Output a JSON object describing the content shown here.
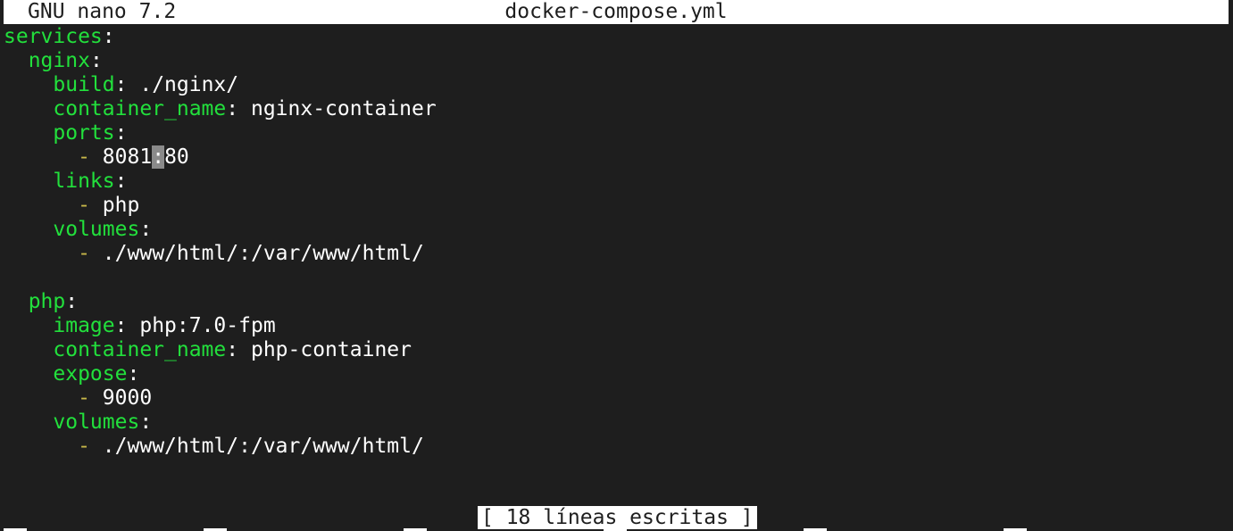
{
  "titlebar": {
    "app_version": "GNU nano 7.2",
    "file_name": "docker-compose.yml"
  },
  "editor": {
    "lines": [
      {
        "indent": "",
        "key": "services",
        "sep": ":",
        "dash": "",
        "value": ""
      },
      {
        "indent": "  ",
        "key": "nginx",
        "sep": ":",
        "dash": "",
        "value": ""
      },
      {
        "indent": "    ",
        "key": "build",
        "sep": ":",
        "dash": "",
        "value": " ./nginx/"
      },
      {
        "indent": "    ",
        "key": "container_name",
        "sep": ":",
        "dash": "",
        "value": " nginx-container"
      },
      {
        "indent": "    ",
        "key": "ports",
        "sep": ":",
        "dash": "",
        "value": ""
      },
      {
        "indent": "      ",
        "key": "",
        "sep": "",
        "dash": "-",
        "value": " 8081",
        "cursor": ":",
        "after": "80"
      },
      {
        "indent": "    ",
        "key": "links",
        "sep": ":",
        "dash": "",
        "value": ""
      },
      {
        "indent": "      ",
        "key": "",
        "sep": "",
        "dash": "-",
        "value": " php"
      },
      {
        "indent": "    ",
        "key": "volumes",
        "sep": ":",
        "dash": "",
        "value": ""
      },
      {
        "indent": "      ",
        "key": "",
        "sep": "",
        "dash": "-",
        "value": " ./www/html/:/var/www/html/"
      },
      {
        "indent": "",
        "key": "",
        "sep": "",
        "dash": "",
        "value": ""
      },
      {
        "indent": "  ",
        "key": "php",
        "sep": ":",
        "dash": "",
        "value": ""
      },
      {
        "indent": "    ",
        "key": "image",
        "sep": ":",
        "dash": "",
        "value": " php:7.0-fpm"
      },
      {
        "indent": "    ",
        "key": "container_name",
        "sep": ":",
        "dash": "",
        "value": " php-container"
      },
      {
        "indent": "    ",
        "key": "expose",
        "sep": ":",
        "dash": "",
        "value": ""
      },
      {
        "indent": "      ",
        "key": "",
        "sep": "",
        "dash": "-",
        "value": " 9000"
      },
      {
        "indent": "    ",
        "key": "volumes",
        "sep": ":",
        "dash": "",
        "value": ""
      },
      {
        "indent": "      ",
        "key": "",
        "sep": "",
        "dash": "-",
        "value": " ./www/html/:/var/www/html/"
      }
    ]
  },
  "status": {
    "message": "[ 18 líneas escritas ]"
  },
  "colors": {
    "background": "#1e1e1e",
    "key": "#22e03c",
    "dash": "#c8b84a",
    "text": "#ffffff",
    "cursor": "#8a8a8a"
  }
}
